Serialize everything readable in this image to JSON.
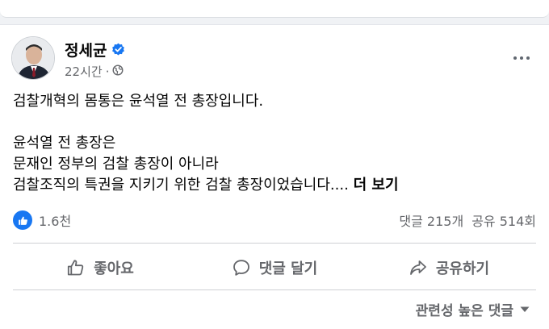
{
  "post": {
    "author": "정세균",
    "time": "22시간",
    "time_separator": "·",
    "icons": {
      "verified": "verified-badge-icon",
      "audience": "globe-icon",
      "more": "more-options-icon"
    },
    "lines": [
      "검찰개혁의 몸통은 윤석열 전 총장입니다.",
      "윤석열 전 총장은",
      "문재인 정부의 검찰 총장이 아니라",
      "검찰조직의 특권을 지키기 위한 검찰 총장이었습니다...."
    ],
    "see_more": "더 보기"
  },
  "stats": {
    "likes": "1.6천",
    "comments": "댓글 215개",
    "shares": "공유 514회"
  },
  "actions": {
    "like": "좋아요",
    "comment": "댓글 달기",
    "share": "공유하기"
  },
  "comments_sort": "관련성 높은 댓글",
  "colors": {
    "accent": "#1877f2",
    "muted": "#65676b"
  }
}
